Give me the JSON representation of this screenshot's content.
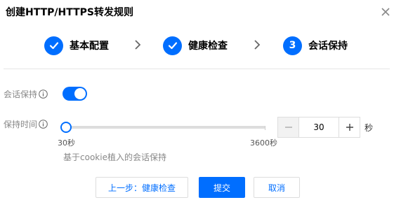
{
  "dialog": {
    "title": "创建HTTP/HTTPS转发规则",
    "close_icon": "close-icon"
  },
  "steps": [
    {
      "marker": "check-icon",
      "label": "基本配置",
      "status": "done"
    },
    {
      "marker": "check-icon",
      "label": "健康检查",
      "status": "done"
    },
    {
      "marker": "3",
      "label": "会话保持",
      "status": "current"
    }
  ],
  "session_persistence": {
    "label": "会话保持",
    "info_icon": "info-icon",
    "enabled": true
  },
  "hold_time": {
    "label": "保持时间",
    "info_icon": "info-icon",
    "min_label": "30秒",
    "max_label": "3600秒",
    "min": 30,
    "max": 3600,
    "value": 30,
    "input_value": "30",
    "unit": "秒",
    "minus_icon": "minus-icon",
    "plus_icon": "plus-icon"
  },
  "hint": "基于cookie植入的会话保持",
  "footer": {
    "prev_label": "上一步：健康检查",
    "submit_label": "提交",
    "cancel_label": "取消"
  },
  "colors": {
    "accent": "#006eff",
    "muted_text": "#888888"
  }
}
